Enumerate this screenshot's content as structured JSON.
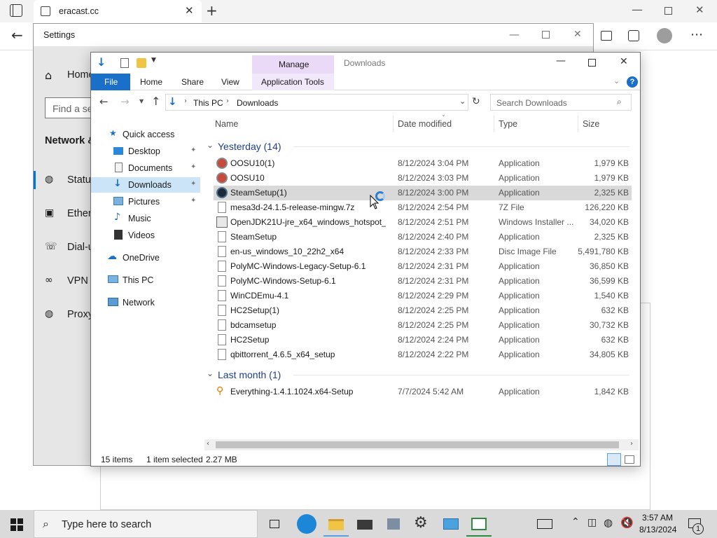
{
  "browser": {
    "tab_title": "eracast.cc",
    "new_tab_icon": "plus-icon"
  },
  "settings": {
    "title": "Settings",
    "home": "Home",
    "search_placeholder": "Find a se",
    "section": "Network &",
    "nav": [
      {
        "label": "Status",
        "icon": "globe-icon"
      },
      {
        "label": "Ether",
        "icon": "ethernet-icon"
      },
      {
        "label": "Dial-u",
        "icon": "dialup-icon"
      },
      {
        "label": "VPN",
        "icon": "vpn-icon"
      },
      {
        "label": "Proxy",
        "icon": "globe-icon"
      }
    ]
  },
  "explorer": {
    "title": "Downloads",
    "manage_label": "Manage",
    "ribbon_tabs": [
      "File",
      "Home",
      "Share",
      "View",
      "Application Tools"
    ],
    "address": {
      "root": "This PC",
      "current": "Downloads"
    },
    "search_placeholder": "Search Downloads",
    "nav": [
      {
        "label": "Quick access",
        "icon": "star-icon"
      },
      {
        "label": "Desktop",
        "icon": "desktop-icon",
        "pinned": true
      },
      {
        "label": "Documents",
        "icon": "documents-icon",
        "pinned": true
      },
      {
        "label": "Downloads",
        "icon": "downloads-icon",
        "pinned": true,
        "selected": true
      },
      {
        "label": "Pictures",
        "icon": "pictures-icon",
        "pinned": true
      },
      {
        "label": "Music",
        "icon": "music-icon"
      },
      {
        "label": "Videos",
        "icon": "videos-icon"
      },
      {
        "label": "OneDrive",
        "icon": "onedrive-icon"
      },
      {
        "label": "This PC",
        "icon": "pc-icon"
      },
      {
        "label": "Network",
        "icon": "network-icon"
      }
    ],
    "columns": [
      "Name",
      "Date modified",
      "Type",
      "Size"
    ],
    "groups": [
      {
        "label": "Yesterday (14)",
        "files": [
          {
            "name": "OOSU10(1)",
            "date": "8/12/2024 3:04 PM",
            "type": "Application",
            "size": "1,979 KB",
            "icon": "oosu-icon"
          },
          {
            "name": "OOSU10",
            "date": "8/12/2024 3:03 PM",
            "type": "Application",
            "size": "1,979 KB",
            "icon": "oosu-icon"
          },
          {
            "name": "SteamSetup(1)",
            "date": "8/12/2024 3:00 PM",
            "type": "Application",
            "size": "2,325 KB",
            "icon": "steam-icon",
            "selected": true
          },
          {
            "name": "mesa3d-24.1.5-release-mingw.7z",
            "date": "8/12/2024 2:54 PM",
            "type": "7Z File",
            "size": "126,220 KB",
            "icon": "file-icon"
          },
          {
            "name": "OpenJDK21U-jre_x64_windows_hotspot_...",
            "date": "8/12/2024 2:51 PM",
            "type": "Windows Installer ...",
            "size": "34,020 KB",
            "icon": "installer-icon"
          },
          {
            "name": "SteamSetup",
            "date": "8/12/2024 2:40 PM",
            "type": "Application",
            "size": "2,325 KB",
            "icon": "file-icon"
          },
          {
            "name": "en-us_windows_10_22h2_x64",
            "date": "8/12/2024 2:33 PM",
            "type": "Disc Image File",
            "size": "5,491,780 KB",
            "icon": "file-icon"
          },
          {
            "name": "PolyMC-Windows-Legacy-Setup-6.1",
            "date": "8/12/2024 2:31 PM",
            "type": "Application",
            "size": "36,850 KB",
            "icon": "file-icon"
          },
          {
            "name": "PolyMC-Windows-Setup-6.1",
            "date": "8/12/2024 2:31 PM",
            "type": "Application",
            "size": "36,599 KB",
            "icon": "file-icon"
          },
          {
            "name": "WinCDEmu-4.1",
            "date": "8/12/2024 2:29 PM",
            "type": "Application",
            "size": "1,540 KB",
            "icon": "file-icon"
          },
          {
            "name": "HC2Setup(1)",
            "date": "8/12/2024 2:25 PM",
            "type": "Application",
            "size": "632 KB",
            "icon": "file-icon"
          },
          {
            "name": "bdcamsetup",
            "date": "8/12/2024 2:25 PM",
            "type": "Application",
            "size": "30,732 KB",
            "icon": "file-icon"
          },
          {
            "name": "HC2Setup",
            "date": "8/12/2024 2:24 PM",
            "type": "Application",
            "size": "632 KB",
            "icon": "file-icon"
          },
          {
            "name": "qbittorrent_4.6.5_x64_setup",
            "date": "8/12/2024 2:22 PM",
            "type": "Application",
            "size": "34,805 KB",
            "icon": "file-icon"
          }
        ]
      },
      {
        "label": "Last month (1)",
        "files": [
          {
            "name": "Everything-1.4.1.1024.x64-Setup",
            "date": "7/7/2024 5:42 AM",
            "type": "Application",
            "size": "1,842 KB",
            "icon": "everything-icon"
          }
        ]
      }
    ],
    "status": {
      "items": "15 items",
      "selected": "1 item selected",
      "size": "2.27 MB"
    }
  },
  "taskbar": {
    "search_placeholder": "Type here to search",
    "time": "3:57 AM",
    "date": "8/13/2024",
    "notification_count": "1"
  },
  "colors": {
    "accent": "#0078d7",
    "file_tab": "#1a6fc8",
    "manage_tab": "#ead9f7",
    "selection_row": "#d9d9d9",
    "nav_selection": "#cce4f7",
    "group_header": "#1e3f8a"
  }
}
